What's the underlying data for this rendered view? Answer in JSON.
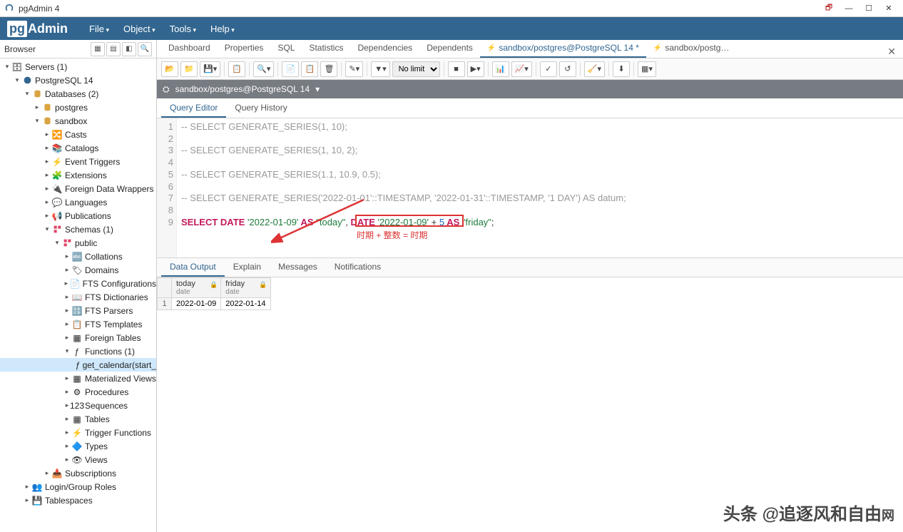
{
  "window": {
    "title": "pgAdmin 4"
  },
  "brand": "Admin",
  "menus": [
    "File",
    "Object",
    "Tools",
    "Help"
  ],
  "browser": {
    "title": "Browser",
    "tree": {
      "servers": "Servers (1)",
      "pg14": "PostgreSQL 14",
      "databases": "Databases (2)",
      "db1": "postgres",
      "db2": "sandbox",
      "casts": "Casts",
      "catalogs": "Catalogs",
      "event_triggers": "Event Triggers",
      "extensions": "Extensions",
      "fdw": "Foreign Data Wrappers",
      "languages": "Languages",
      "publications": "Publications",
      "schemas": "Schemas (1)",
      "public": "public",
      "collations": "Collations",
      "domains": "Domains",
      "fts_conf": "FTS Configurations",
      "fts_dict": "FTS Dictionaries",
      "fts_parsers": "FTS Parsers",
      "fts_templates": "FTS Templates",
      "foreign_tables": "Foreign Tables",
      "functions": "Functions (1)",
      "func1": "get_calendar(start_",
      "mat_views": "Materialized Views",
      "procedures": "Procedures",
      "sequences": "Sequences",
      "tables": "Tables",
      "trig_funcs": "Trigger Functions",
      "types": "Types",
      "views": "Views",
      "subscriptions": "Subscriptions",
      "login_roles": "Login/Group Roles",
      "tablespaces": "Tablespaces"
    }
  },
  "main_tabs": {
    "dashboard": "Dashboard",
    "properties": "Properties",
    "sql": "SQL",
    "statistics": "Statistics",
    "dependencies": "Dependencies",
    "dependents": "Dependents",
    "qtool_active": "sandbox/postgres@PostgreSQL 14 *",
    "qtool2": "sandbox/postg…"
  },
  "toolbar": {
    "limit": "No limit"
  },
  "connection": {
    "label": "sandbox/postgres@PostgreSQL 14"
  },
  "query_tabs": {
    "editor": "Query Editor",
    "history": "Query History"
  },
  "code": {
    "l1": "-- SELECT GENERATE_SERIES(1, 10);",
    "l3": "-- SELECT GENERATE_SERIES(1, 10, 2);",
    "l5": "-- SELECT GENERATE_SERIES(1.1, 10.9, 0.5);",
    "l7": "-- SELECT GENERATE_SERIES('2022-01-01'::TIMESTAMP, '2022-01-31'::TIMESTAMP, '1 DAY') AS datum;",
    "l9_select": "SELECT",
    "l9_date1": " DATE ",
    "l9_str1": "'2022-01-09'",
    "l9_as1": " AS ",
    "l9_alias1": "\"today\"",
    "l9_comma": ", ",
    "l9_date2": "DATE ",
    "l9_str2": "'2022-01-09'",
    "l9_plus": " + ",
    "l9_num": "5",
    "l9_as2": " AS ",
    "l9_alias2": "\"friday\"",
    "l9_end": ";"
  },
  "annotation": "时期 + 整数 = 时期",
  "output_tabs": {
    "data": "Data Output",
    "explain": "Explain",
    "messages": "Messages",
    "notif": "Notifications"
  },
  "grid": {
    "cols": [
      {
        "name": "today",
        "type": "date"
      },
      {
        "name": "friday",
        "type": "date"
      }
    ],
    "rows": [
      {
        "n": "1",
        "c0": "2022-01-09",
        "c1": "2022-01-14"
      }
    ]
  },
  "watermark": {
    "a": "头条 @追逐风和自由",
    "b": "网"
  }
}
